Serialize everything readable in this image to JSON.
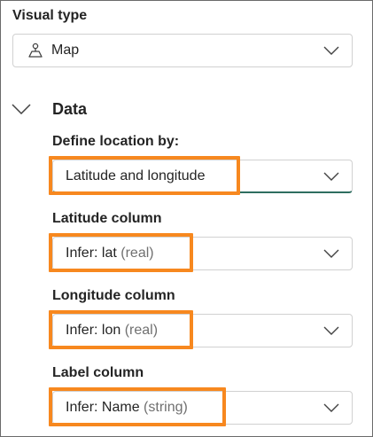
{
  "visual_type": {
    "label": "Visual type",
    "selected": "Map",
    "icon": "map-pin-person-icon"
  },
  "data_section": {
    "title": "Data",
    "expanded": true,
    "define_location": {
      "label": "Define location by:",
      "value": "Latitude and longitude"
    },
    "latitude": {
      "label": "Latitude column",
      "value_main": "Infer: lat",
      "value_type": "(real)"
    },
    "longitude": {
      "label": "Longitude column",
      "value_main": "Infer: lon",
      "value_type": "(real)"
    },
    "label_column": {
      "label": "Label column",
      "value_main": "Infer: Name",
      "value_type": "(string)"
    }
  },
  "colors": {
    "highlight": "#f7881f",
    "focus_underline": "#2e6e60",
    "border": "#d1d1d1"
  }
}
